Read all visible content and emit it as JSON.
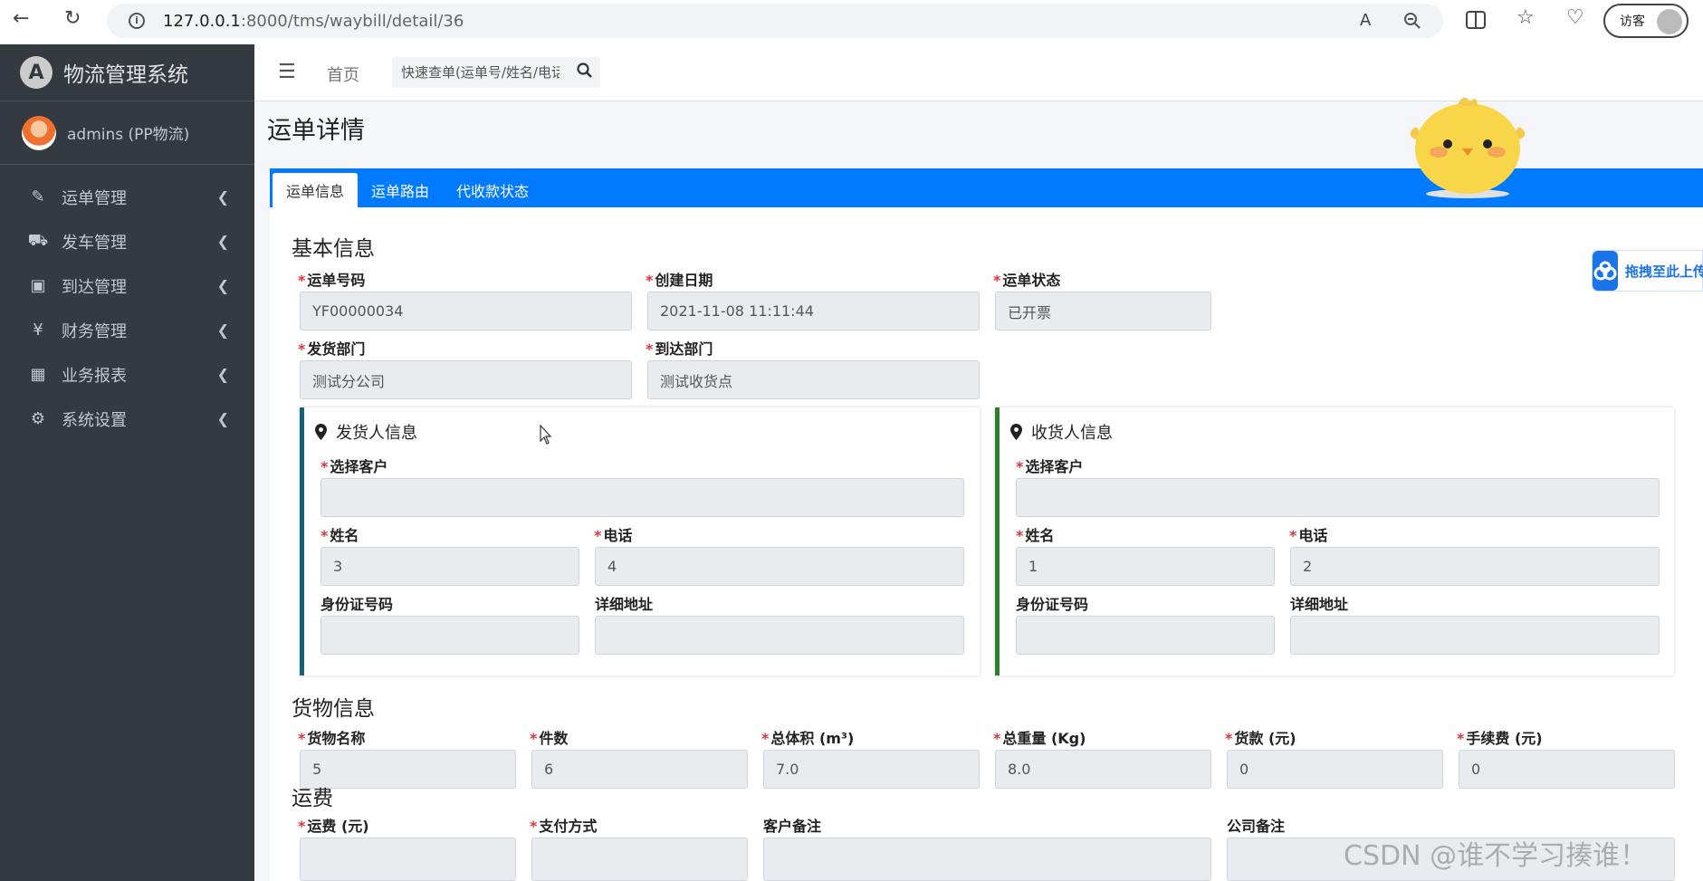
{
  "browser": {
    "url_host": "127.0.0.1",
    "url_path": ":8000/tms/waybill/detail/36",
    "visitor_label": "访客"
  },
  "sidebar": {
    "brand": "物流管理系统",
    "user": "admins (PP物流)",
    "items": [
      {
        "label": "运单管理",
        "icon": "clipboard-icon"
      },
      {
        "label": "发车管理",
        "icon": "truck-icon"
      },
      {
        "label": "到达管理",
        "icon": "dolly-icon"
      },
      {
        "label": "财务管理",
        "icon": "yen-icon"
      },
      {
        "label": "业务报表",
        "icon": "table-icon"
      },
      {
        "label": "系统设置",
        "icon": "gear-icon"
      }
    ]
  },
  "topbar": {
    "home": "首页",
    "search_placeholder": "快速查单(运单号/姓名/电话)"
  },
  "page": {
    "title": "运单详情",
    "tabs": [
      "运单信息",
      "运单路由",
      "代收款状态"
    ]
  },
  "basic": {
    "section": "基本信息",
    "waybill_no_label": "运单号码",
    "waybill_no": "YF00000034",
    "created_label": "创建日期",
    "created": "2021-11-08 11:11:44",
    "status_label": "运单状态",
    "status": "已开票",
    "from_dept_label": "发货部门",
    "from_dept": "测试分公司",
    "to_dept_label": "到达部门",
    "to_dept": "测试收货点"
  },
  "sender": {
    "title": "发货人信息",
    "customer_label": "选择客户",
    "customer": "",
    "name_label": "姓名",
    "name": "3",
    "phone_label": "电话",
    "phone": "4",
    "id_label": "身份证号码",
    "id": "",
    "addr_label": "详细地址",
    "addr": ""
  },
  "receiver": {
    "title": "收货人信息",
    "customer_label": "选择客户",
    "customer": "",
    "name_label": "姓名",
    "name": "1",
    "phone_label": "电话",
    "phone": "2",
    "id_label": "身份证号码",
    "id": "",
    "addr_label": "详细地址",
    "addr": ""
  },
  "goods": {
    "section": "货物信息",
    "fields": [
      {
        "label": "货物名称",
        "value": "5"
      },
      {
        "label": "件数",
        "value": "6"
      },
      {
        "label": "总体积 (m³)",
        "value": "7.0"
      },
      {
        "label": "总重量 (Kg)",
        "value": "8.0"
      },
      {
        "label": "货款 (元)",
        "value": "0"
      },
      {
        "label": "手续费 (元)",
        "value": "0"
      }
    ]
  },
  "freight": {
    "section": "运费",
    "fee_label": "运费 (元)",
    "pay_label": "支付方式",
    "cust_note_label": "客户备注",
    "comp_note_label": "公司备注"
  },
  "overlay": {
    "cloud_text": "拖拽至此上传",
    "watermark": "CSDN @谁不学习揍谁！"
  },
  "colors": {
    "accent": "#007bff",
    "sidebar": "#343a40",
    "sender_border": "#17607a",
    "receiver_border": "#2e7d32"
  }
}
